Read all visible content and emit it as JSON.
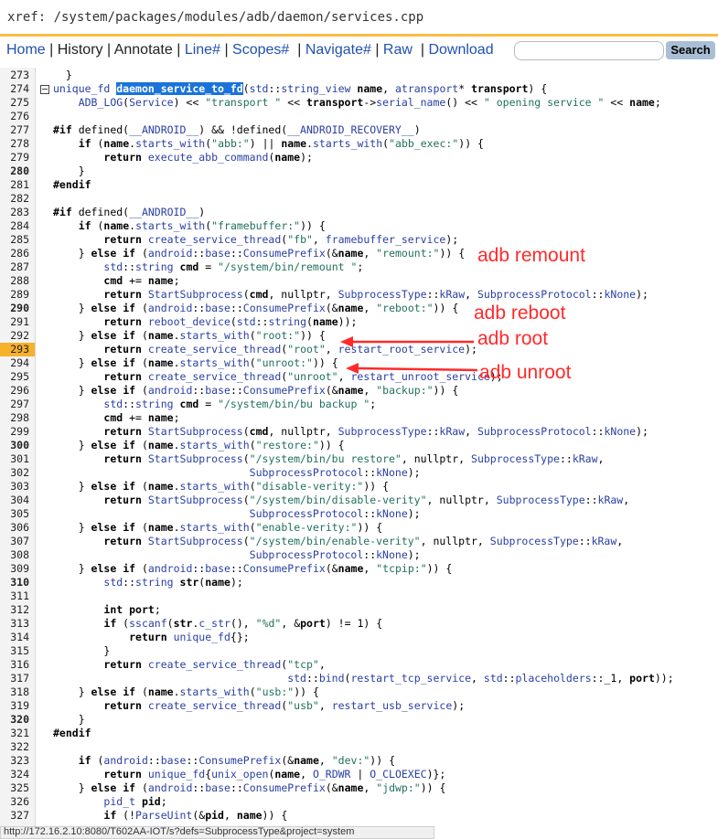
{
  "path_bar": {
    "text": "xref: /system/packages/modules/adb/daemon/services.cpp"
  },
  "nav": {
    "home": "Home",
    "history": "History",
    "annotate": "Annotate",
    "line": "Line#",
    "scopes": "Scopes#",
    "navigate": "Navigate#",
    "raw": "Raw",
    "download": "Download",
    "separator": "|",
    "search_placeholder": "",
    "search_button": "Search"
  },
  "highlighted_line": "293",
  "code_lines": [
    {
      "n": "273",
      "b": false,
      "t": "  }"
    },
    {
      "n": "274",
      "b": false,
      "t": "unique_fd daemon_service_to_fd(std::string_view name, atransport* transport) {"
    },
    {
      "n": "275",
      "b": false,
      "t": "    ADB_LOG(Service) << \"transport \" << transport->serial_name() << \" opening service \" << name;"
    },
    {
      "n": "276",
      "b": false,
      "t": ""
    },
    {
      "n": "277",
      "b": false,
      "t": "#if defined(__ANDROID__) && !defined(__ANDROID_RECOVERY__)"
    },
    {
      "n": "278",
      "b": false,
      "t": "    if (name.starts_with(\"abb:\") || name.starts_with(\"abb_exec:\")) {"
    },
    {
      "n": "279",
      "b": false,
      "t": "        return execute_abb_command(name);"
    },
    {
      "n": "280",
      "b": true,
      "t": "    }"
    },
    {
      "n": "281",
      "b": false,
      "t": "#endif"
    },
    {
      "n": "282",
      "b": false,
      "t": ""
    },
    {
      "n": "283",
      "b": false,
      "t": "#if defined(__ANDROID__)"
    },
    {
      "n": "284",
      "b": false,
      "t": "    if (name.starts_with(\"framebuffer:\")) {"
    },
    {
      "n": "285",
      "b": false,
      "t": "        return create_service_thread(\"fb\", framebuffer_service);"
    },
    {
      "n": "286",
      "b": false,
      "t": "    } else if (android::base::ConsumePrefix(&name, \"remount:\")) {"
    },
    {
      "n": "287",
      "b": false,
      "t": "        std::string cmd = \"/system/bin/remount \";"
    },
    {
      "n": "288",
      "b": false,
      "t": "        cmd += name;"
    },
    {
      "n": "289",
      "b": false,
      "t": "        return StartSubprocess(cmd, nullptr, SubprocessType::kRaw, SubprocessProtocol::kNone);"
    },
    {
      "n": "290",
      "b": true,
      "t": "    } else if (android::base::ConsumePrefix(&name, \"reboot:\")) {"
    },
    {
      "n": "291",
      "b": false,
      "t": "        return reboot_device(std::string(name));"
    },
    {
      "n": "292",
      "b": false,
      "t": "    } else if (name.starts_with(\"root:\")) {"
    },
    {
      "n": "293",
      "b": false,
      "t": "        return create_service_thread(\"root\", restart_root_service);"
    },
    {
      "n": "294",
      "b": false,
      "t": "    } else if (name.starts_with(\"unroot:\")) {"
    },
    {
      "n": "295",
      "b": false,
      "t": "        return create_service_thread(\"unroot\", restart_unroot_service);"
    },
    {
      "n": "296",
      "b": false,
      "t": "    } else if (android::base::ConsumePrefix(&name, \"backup:\")) {"
    },
    {
      "n": "297",
      "b": false,
      "t": "        std::string cmd = \"/system/bin/bu backup \";"
    },
    {
      "n": "298",
      "b": false,
      "t": "        cmd += name;"
    },
    {
      "n": "299",
      "b": false,
      "t": "        return StartSubprocess(cmd, nullptr, SubprocessType::kRaw, SubprocessProtocol::kNone);"
    },
    {
      "n": "300",
      "b": true,
      "t": "    } else if (name.starts_with(\"restore:\")) {"
    },
    {
      "n": "301",
      "b": false,
      "t": "        return StartSubprocess(\"/system/bin/bu restore\", nullptr, SubprocessType::kRaw,"
    },
    {
      "n": "302",
      "b": false,
      "t": "                               SubprocessProtocol::kNone);"
    },
    {
      "n": "303",
      "b": false,
      "t": "    } else if (name.starts_with(\"disable-verity:\")) {"
    },
    {
      "n": "304",
      "b": false,
      "t": "        return StartSubprocess(\"/system/bin/disable-verity\", nullptr, SubprocessType::kRaw,"
    },
    {
      "n": "305",
      "b": false,
      "t": "                               SubprocessProtocol::kNone);"
    },
    {
      "n": "306",
      "b": false,
      "t": "    } else if (name.starts_with(\"enable-verity:\")) {"
    },
    {
      "n": "307",
      "b": false,
      "t": "        return StartSubprocess(\"/system/bin/enable-verity\", nullptr, SubprocessType::kRaw,"
    },
    {
      "n": "308",
      "b": false,
      "t": "                               SubprocessProtocol::kNone);"
    },
    {
      "n": "309",
      "b": false,
      "t": "    } else if (android::base::ConsumePrefix(&name, \"tcpip:\")) {"
    },
    {
      "n": "310",
      "b": true,
      "t": "        std::string str(name);"
    },
    {
      "n": "311",
      "b": false,
      "t": ""
    },
    {
      "n": "312",
      "b": false,
      "t": "        int port;"
    },
    {
      "n": "313",
      "b": false,
      "t": "        if (sscanf(str.c_str(), \"%d\", &port) != 1) {"
    },
    {
      "n": "314",
      "b": false,
      "t": "            return unique_fd{};"
    },
    {
      "n": "315",
      "b": false,
      "t": "        }"
    },
    {
      "n": "316",
      "b": false,
      "t": "        return create_service_thread(\"tcp\","
    },
    {
      "n": "317",
      "b": false,
      "t": "                                     std::bind(restart_tcp_service, std::placeholders::_1, port));"
    },
    {
      "n": "318",
      "b": false,
      "t": "    } else if (name.starts_with(\"usb:\")) {"
    },
    {
      "n": "319",
      "b": false,
      "t": "        return create_service_thread(\"usb\", restart_usb_service);"
    },
    {
      "n": "320",
      "b": true,
      "t": "    }"
    },
    {
      "n": "321",
      "b": false,
      "t": "#endif"
    },
    {
      "n": "322",
      "b": false,
      "t": ""
    },
    {
      "n": "323",
      "b": false,
      "t": "    if (android::base::ConsumePrefix(&name, \"dev:\")) {"
    },
    {
      "n": "324",
      "b": false,
      "t": "        return unique_fd{unix_open(name, O_RDWR | O_CLOEXEC)};"
    },
    {
      "n": "325",
      "b": false,
      "t": "    } else if (android::base::ConsumePrefix(&name, \"jdwp:\")) {"
    },
    {
      "n": "326",
      "b": false,
      "t": "        pid_t pid;"
    },
    {
      "n": "327",
      "b": false,
      "t": "        if (!ParseUint(&pid, name)) {"
    }
  ],
  "annotations": {
    "remount": "adb remount",
    "reboot": "adb reboot",
    "root": "adb root",
    "unroot": "adb unroot",
    "color": "#ff2a2a"
  },
  "status_bar": {
    "url": "http://172.16.2.10:8080/T602AA-IOT/s?defs=SubprocessType&project=system"
  },
  "colors": {
    "accent_rule": "#fbbc43",
    "highlight": "#f7b12a",
    "selection": "#1a73d9",
    "link": "#2050b0"
  }
}
